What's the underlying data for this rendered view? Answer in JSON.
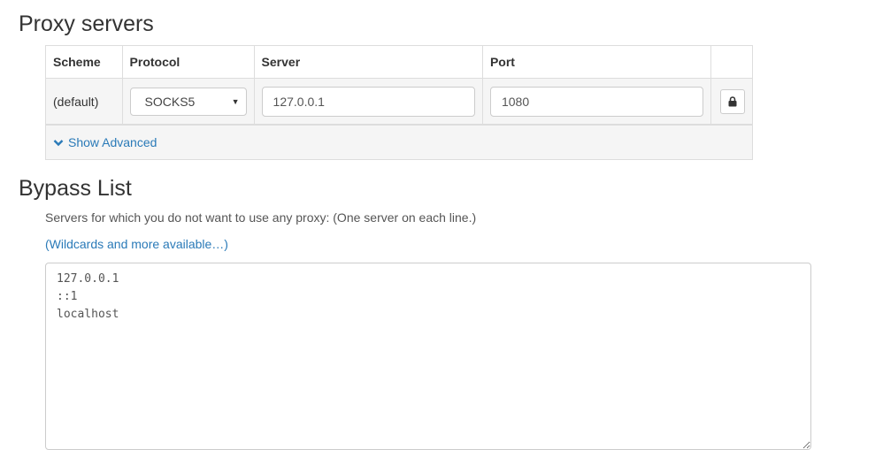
{
  "proxy_section": {
    "title": "Proxy servers",
    "columns": [
      "Scheme",
      "Protocol",
      "Server",
      "Port"
    ],
    "row": {
      "scheme": "(default)",
      "protocol": "SOCKS5",
      "server": "127.0.0.1",
      "port": "1080"
    },
    "show_advanced": "Show Advanced"
  },
  "bypass_section": {
    "title": "Bypass List",
    "help": "Servers for which you do not want to use any proxy: (One server on each line.)",
    "wildcards_link": "(Wildcards and more available…)",
    "entries": "127.0.0.1\n::1\nlocalhost"
  },
  "icons": {
    "lock": "lock-icon",
    "chevron": "chevron-down-icon",
    "dropdown": "caret-down-icon"
  },
  "colors": {
    "link": "#2a7ab8",
    "row_bg": "#f5f5f5",
    "border": "#dddddd"
  }
}
